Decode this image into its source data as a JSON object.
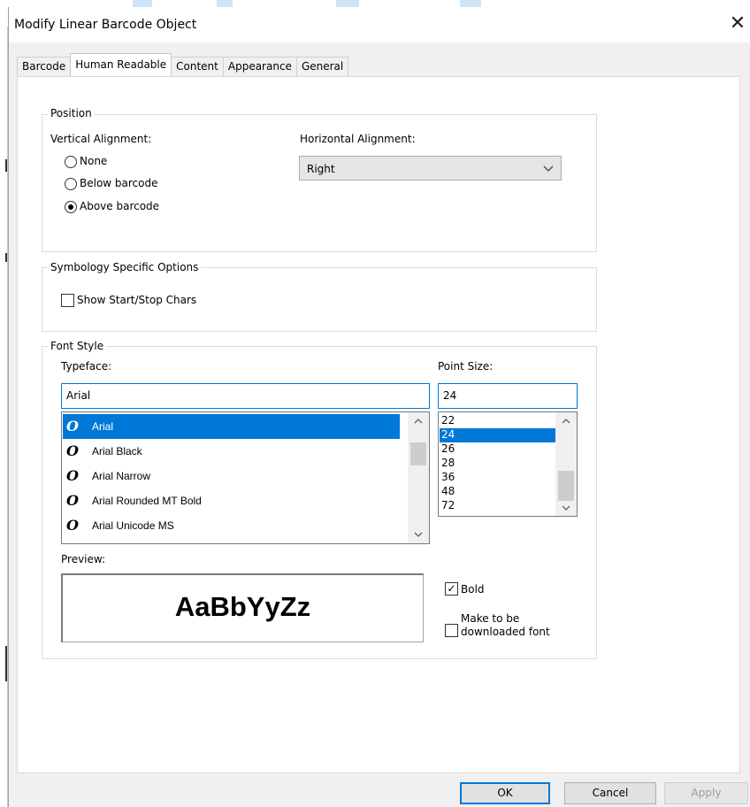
{
  "window": {
    "title": "Modify Linear Barcode Object",
    "close_glyph": "✕"
  },
  "tabs": [
    {
      "label": "Barcode",
      "active": false
    },
    {
      "label": "Human Readable",
      "active": true
    },
    {
      "label": "Content",
      "active": false
    },
    {
      "label": "Appearance",
      "active": false
    },
    {
      "label": "General",
      "active": false
    }
  ],
  "position": {
    "group_label": "Position",
    "vertical_label": "Vertical Alignment:",
    "options": [
      {
        "label": "None",
        "checked": false
      },
      {
        "label": "Below barcode",
        "checked": false
      },
      {
        "label": "Above barcode",
        "checked": true
      }
    ],
    "horizontal_label": "Horizontal Alignment:",
    "horizontal_value": "Right"
  },
  "symbology": {
    "group_label": "Symbology Specific Options",
    "show_start_stop_label": "Show Start/Stop Chars",
    "show_start_stop_checked": false
  },
  "font_style": {
    "group_label": "Font Style",
    "typeface_label": "Typeface:",
    "typeface_value": "Arial",
    "typeface_icon_glyph": "O",
    "typefaces": [
      {
        "name": "Arial",
        "selected": true
      },
      {
        "name": "Arial Black",
        "selected": false
      },
      {
        "name": "Arial Narrow",
        "selected": false
      },
      {
        "name": "Arial Rounded MT Bold",
        "selected": false
      },
      {
        "name": "Arial Unicode MS",
        "selected": false
      }
    ],
    "point_size_label": "Point Size:",
    "point_size_value": "24",
    "sizes": [
      "22",
      "24",
      "26",
      "28",
      "36",
      "48",
      "72"
    ],
    "selected_size": "24",
    "preview_label": "Preview:",
    "preview_text": "AaBbYyZz",
    "bold_label": "Bold",
    "bold_checked": true,
    "download_label_line1": "Make to be",
    "download_label_line2": "downloaded font",
    "download_checked": false
  },
  "buttons": {
    "ok": "OK",
    "cancel": "Cancel",
    "apply": "Apply"
  },
  "colors": {
    "selection": "#0078d7",
    "dialog_bg": "#f0f0f0"
  }
}
